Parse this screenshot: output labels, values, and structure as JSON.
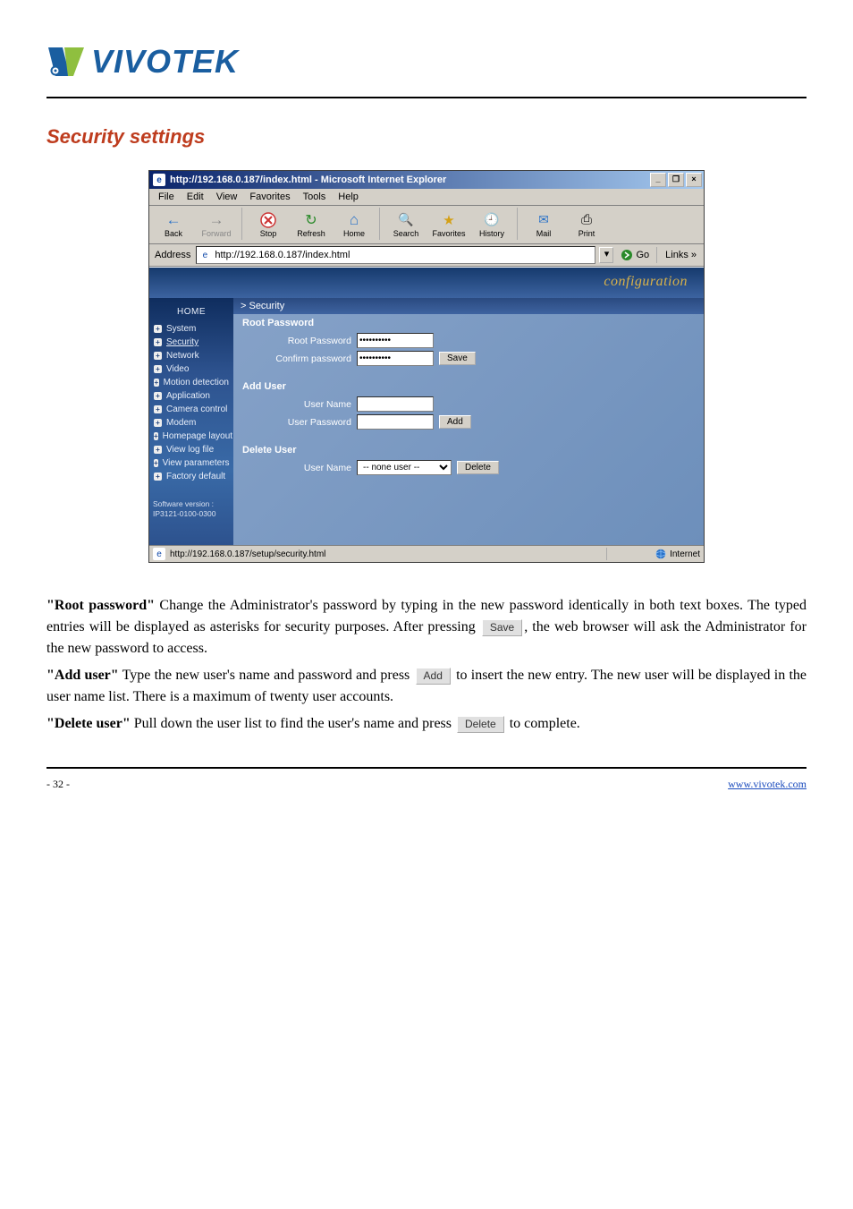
{
  "logo": {
    "text": "VIVOTEK"
  },
  "section_heading": "Security settings",
  "paragraphs": {
    "root_pw": "Change the Administrator's password by typing in the new password identically in both text boxes. The typed entries will be displayed as asterisks for security purposes. After pressing ",
    "root_pw_after": ", the web browser will ask the Administrator for the new password to access.",
    "add_user": "Type the new user's name and password and press ",
    "add_user_after": " to insert the new entry. The new user will be displayed in the user name list. There is a maximum of twenty user accounts.",
    "delete_user": "Pull down the user list to find the user's name and press ",
    "delete_user_after": " to complete."
  },
  "inline_buttons": {
    "save": "Save",
    "add": "Add",
    "delete": "Delete"
  },
  "run_labels": {
    "root_pw_label": "\"Root password\"",
    "add_user_label": "\"Add user\"",
    "delete_user_label": "\"Delete user\""
  },
  "ie": {
    "title": "http://192.168.0.187/index.html - Microsoft Internet Explorer",
    "menus": [
      "File",
      "Edit",
      "View",
      "Favorites",
      "Tools",
      "Help"
    ],
    "toolbar": [
      {
        "id": "back",
        "label": "Back",
        "ico": "←"
      },
      {
        "id": "fwd",
        "label": "Forward",
        "ico": "→",
        "disabled": true
      },
      {
        "id": "stop",
        "label": "Stop",
        "ico": "✖"
      },
      {
        "id": "refresh",
        "label": "Refresh",
        "ico": "↻"
      },
      {
        "id": "home",
        "label": "Home",
        "ico": "⌂"
      },
      {
        "id": "search",
        "label": "Search",
        "ico": "🔍"
      },
      {
        "id": "fav",
        "label": "Favorites",
        "ico": "★"
      },
      {
        "id": "hist",
        "label": "History",
        "ico": "🕘"
      },
      {
        "id": "mail",
        "label": "Mail",
        "ico": "✉"
      },
      {
        "id": "print",
        "label": "Print",
        "ico": "⎙"
      }
    ],
    "address_label": "Address",
    "address_value": "http://192.168.0.187/index.html",
    "go": "Go",
    "links": "Links »",
    "status_left": "http://192.168.0.187/setup/security.html",
    "status_right": "Internet"
  },
  "config": {
    "banner": "configuration",
    "panel_title": "> Security",
    "home": "HOME",
    "sidebar": [
      "System",
      "Security",
      "Network",
      "Video",
      "Motion detection",
      "Application",
      "Camera control",
      "Modem",
      "Homepage layout",
      "View log file",
      "View parameters",
      "Factory default"
    ],
    "version_label": "Software version :",
    "version_value": "IP3121-0100-0300",
    "root_section": "Root Password",
    "root_password_label": "Root Password",
    "confirm_password_label": "Confirm password",
    "password_mask": "**********",
    "save_btn": "Save",
    "add_section": "Add User",
    "user_name_label": "User Name",
    "user_password_label": "User Password",
    "add_btn": "Add",
    "delete_section": "Delete User",
    "delete_user_name_label": "User Name",
    "delete_select_value": "-- none user --",
    "delete_btn": "Delete"
  },
  "footer": {
    "left": "- 32 -",
    "right_label": "www.vivotek.com",
    "right_href": "http://www.vivotek.com"
  }
}
